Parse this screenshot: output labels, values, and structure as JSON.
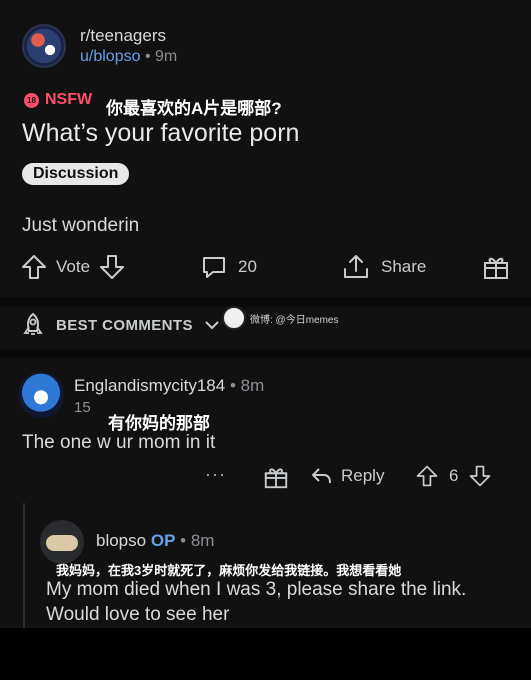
{
  "post": {
    "subreddit": "r/teenagers",
    "author": "u/blopso",
    "separator": "•",
    "age": "9m",
    "nsfw_label": "NSFW",
    "nsfw_badge": "18",
    "title_cn": "你最喜欢的A片是哪部?",
    "title": "What’s your favorite porn",
    "flair": "Discussion",
    "body": "Just wonderin",
    "vote_label": "Vote",
    "comment_count": "20",
    "share_label": "Share"
  },
  "sort": {
    "label": "BEST COMMENTS",
    "watermark": "微博: @今日memes"
  },
  "comments": [
    {
      "author": "Englandismycity184",
      "separator": "•",
      "age": "8m",
      "score": "15",
      "text_cn": "有你妈的那部",
      "text": "The one w ur mom in it",
      "more": "···",
      "reply_label": "Reply",
      "votes": "6"
    },
    {
      "author": "blopso",
      "op_label": "OP",
      "separator": "•",
      "age": "8m",
      "text_cn": "我妈妈，在我3岁时就死了，麻烦你发给我链接。我想看看她",
      "text": "My mom died when I was 3, please share the link. Would love to see her"
    }
  ],
  "colors": {
    "background": "#111112",
    "link_blue": "#6aa0e8",
    "nsfw_red": "#ff4f6a",
    "muted": "#8b8f94"
  }
}
